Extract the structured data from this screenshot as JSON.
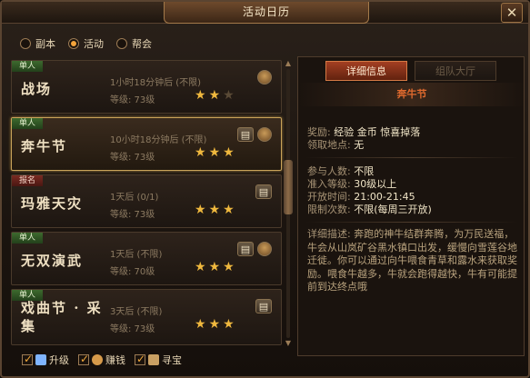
{
  "window": {
    "title": "活动日历",
    "close_label": "✕"
  },
  "modes": [
    {
      "label": "副本",
      "selected": false
    },
    {
      "label": "活动",
      "selected": true
    },
    {
      "label": "帮会",
      "selected": false
    }
  ],
  "activities": [
    {
      "tag": "单人",
      "tag_color": "green",
      "name": "战场",
      "time": "1小时18分钟后 (不限)",
      "level": "等级: 73级",
      "stars": 2.5,
      "icons": [
        "bag-icon"
      ],
      "selected": false
    },
    {
      "tag": "单人",
      "tag_color": "green",
      "name": "奔牛节",
      "time": "10小时18分钟后 (不限)",
      "level": "等级: 73级",
      "stars": 3,
      "icons": [
        "scroll-icon",
        "bag-icon"
      ],
      "selected": true
    },
    {
      "tag": "报名",
      "tag_color": "red",
      "name": "玛雅天灾",
      "time": "1天后 (0/1)",
      "level": "等级: 73级",
      "stars": 3,
      "icons": [
        "scroll-icon"
      ],
      "selected": false
    },
    {
      "tag": "单人",
      "tag_color": "green",
      "name": "无双演武",
      "time": "1天后 (不限)",
      "level": "等级: 70级",
      "stars": 3,
      "icons": [
        "scroll-icon",
        "bag-icon"
      ],
      "selected": false
    },
    {
      "tag": "单人",
      "tag_color": "green",
      "name": "戏曲节 · 采集",
      "time": "3天后 (不限)",
      "level": "等级: 73级",
      "stars": 3,
      "icons": [
        "scroll-icon"
      ],
      "selected": false
    }
  ],
  "tabs": [
    {
      "label": "详细信息",
      "active": true
    },
    {
      "label": "组队大厅",
      "active": false
    }
  ],
  "detail": {
    "title": "奔牛节",
    "reward_label": "奖励: ",
    "reward_value": "经验 金币 惊喜掉落",
    "location_label": "领取地点: ",
    "location_value": "无",
    "participants_label": "参与人数: ",
    "participants_value": "不限",
    "level_label": "准入等级: ",
    "level_value": "30级以上",
    "open_label": "开放时间: ",
    "open_value": "21:00-21:45",
    "limit_label": "限制次数: ",
    "limit_value": "不限(每周三开放)",
    "desc_label": "详细描述: ",
    "desc_text": "奔跑的神牛结群奔腾，为万民送福，牛会从山岚矿谷黑水镇口出发，缓慢向雪莲谷地迁徙。你可以通过向牛喂食青草和露水来获取奖励。喂食牛越多，牛就会跑得越快，牛有可能提前到达终点哦"
  },
  "toggles": [
    {
      "label": "升级",
      "checked": true,
      "icon": "upgrade-icon",
      "icon_color": "#7fb4ff"
    },
    {
      "label": "赚钱",
      "checked": true,
      "icon": "money-icon",
      "icon_color": "#d69a4a"
    },
    {
      "label": "寻宝",
      "checked": true,
      "icon": "treasure-icon",
      "icon_color": "#c9a063"
    }
  ],
  "colors": {
    "accent": "#f4a43b",
    "tab_active": "#a33f22",
    "title_red": "#e06a2e"
  }
}
